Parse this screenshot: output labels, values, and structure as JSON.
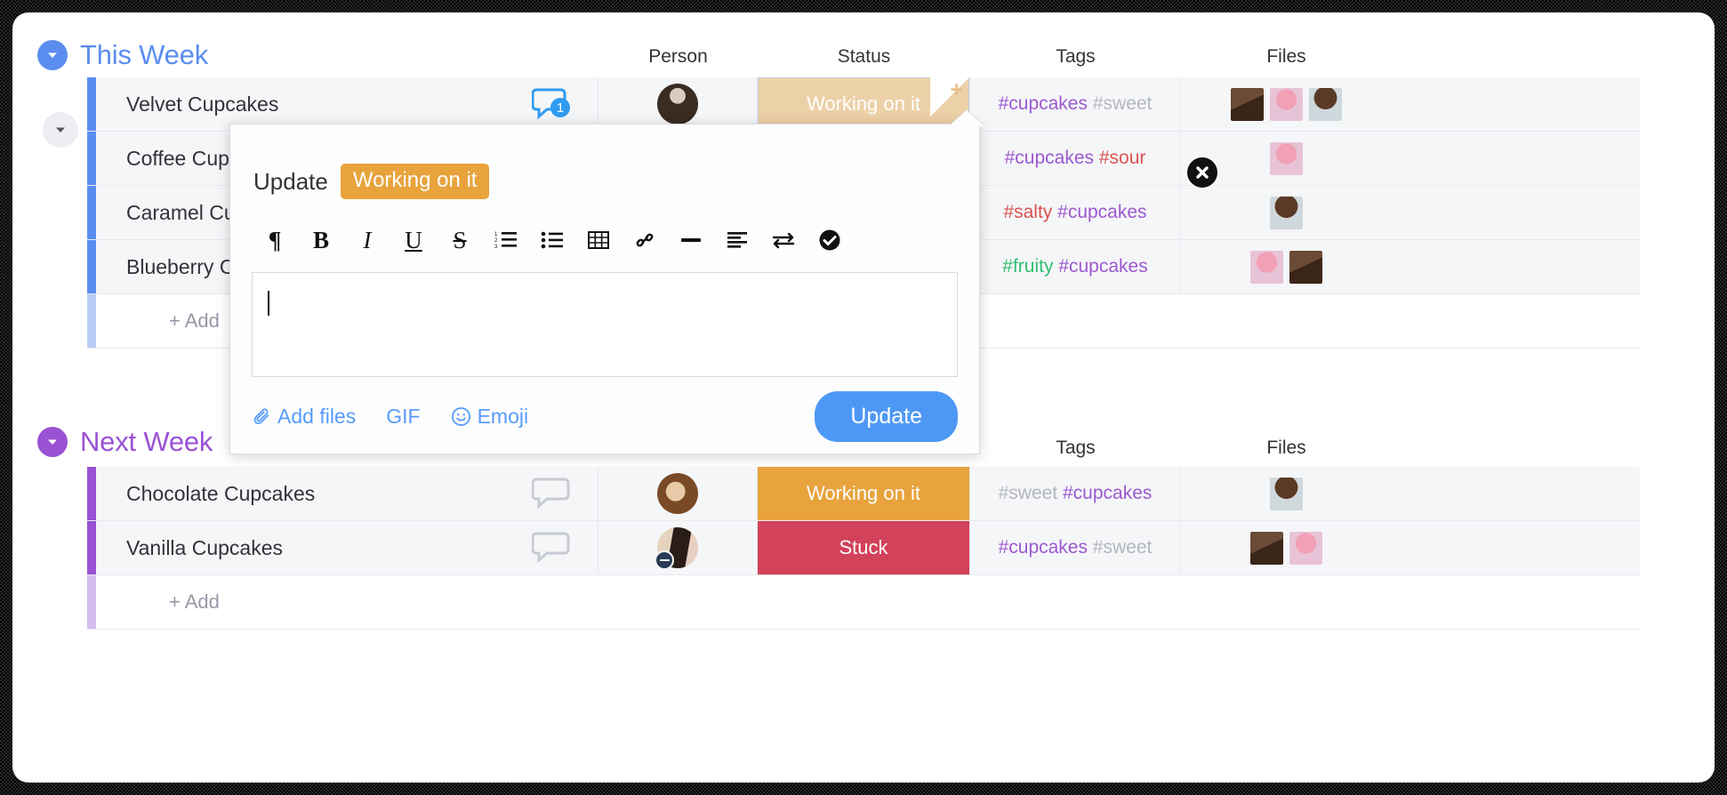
{
  "theme": {
    "this_week_accent": "#5b8def",
    "next_week_accent": "#9a52d4",
    "status_working": "#e8a33d",
    "status_working_selected": "#ecd0a7",
    "status_stuck": "#d2425a",
    "link_blue": "#579bfc",
    "button_blue": "#4e98f5",
    "tag_purple": "#9b59d0",
    "tag_grey": "#b3b6c0",
    "tag_red": "#d9534f",
    "tag_green": "#2fbf71"
  },
  "columns": {
    "person": "Person",
    "status": "Status",
    "tags": "Tags",
    "files": "Files"
  },
  "groups": [
    {
      "title": "This Week",
      "collapse_icon": "chevron-down-circle-icon",
      "add_label": "+ Add",
      "rows": [
        {
          "name": "Velvet Cupcakes",
          "comment_icon": "chat-bubble-icon",
          "comment_count": "1",
          "has_comments": true,
          "person_avatar": "avatar-woman-dark-hair",
          "person_badge": "",
          "status": "Working on it",
          "status_state": "selected",
          "fold_icon": "plus-icon",
          "tags": [
            {
              "text": "#cupcakes",
              "color": "#9b59d0"
            },
            {
              "text": "#sweet",
              "color": "#b3b6c0"
            }
          ],
          "files": [
            "chocolate-cupcake-thumb",
            "pink-cupcake-thumb",
            "choco-swirl-cupcake-thumb"
          ]
        },
        {
          "name": "Coffee Cupcakes",
          "comment_icon": "chat-bubble-icon",
          "comment_count": "",
          "has_comments": false,
          "person_avatar": "",
          "person_badge": "",
          "status": "",
          "status_state": "hidden",
          "tags": [
            {
              "text": "#cupcakes",
              "color": "#9b59d0"
            },
            {
              "text": "#sour",
              "color": "#d9534f"
            }
          ],
          "files": [
            "pink-cupcake-thumb"
          ]
        },
        {
          "name": "Caramel Cupcakes",
          "comment_icon": "chat-bubble-icon",
          "comment_count": "",
          "has_comments": false,
          "person_avatar": "",
          "person_badge": "",
          "status": "",
          "status_state": "hidden",
          "tags": [
            {
              "text": "#salty",
              "color": "#d9534f"
            },
            {
              "text": "#cupcakes",
              "color": "#9b59d0"
            }
          ],
          "files": [
            "choco-swirl-cupcake-thumb"
          ]
        },
        {
          "name": "Blueberry Cupcakes",
          "comment_icon": "chat-bubble-icon",
          "comment_count": "",
          "has_comments": false,
          "person_avatar": "",
          "person_badge": "",
          "status": "",
          "status_state": "hidden",
          "tags": [
            {
              "text": "#fruity",
              "color": "#2fbf71"
            },
            {
              "text": "#cupcakes",
              "color": "#9b59d0"
            }
          ],
          "files": [
            "pink-cupcake-thumb",
            "chocolate-cupcake-thumb"
          ]
        }
      ]
    },
    {
      "title": "Next Week",
      "collapse_icon": "chevron-down-circle-icon",
      "add_label": "+ Add",
      "rows": [
        {
          "name": "Chocolate Cupcakes",
          "comment_icon": "chat-bubble-icon",
          "comment_count": "",
          "has_comments": false,
          "person_avatar": "avatar-woman-curly-hair",
          "person_badge": "",
          "status": "Working on it",
          "status_state": "filled",
          "status_color": "#e8a33d",
          "tags": [
            {
              "text": "#sweet",
              "color": "#b3b6c0"
            },
            {
              "text": "#cupcakes",
              "color": "#9b59d0"
            }
          ],
          "files": [
            "choco-swirl-cupcake-thumb"
          ]
        },
        {
          "name": "Vanilla Cupcakes",
          "comment_icon": "chat-bubble-icon",
          "comment_count": "",
          "has_comments": false,
          "person_avatar": "avatar-woman-long-hair",
          "person_badge": "do-not-disturb-badge",
          "status": "Stuck",
          "status_state": "filled",
          "status_color": "#d2425a",
          "tags": [
            {
              "text": "#cupcakes",
              "color": "#9b59d0"
            },
            {
              "text": "#sweet",
              "color": "#b3b6c0"
            }
          ],
          "files": [
            "chocolate-cupcake-thumb",
            "pink-cupcake-thumb"
          ]
        }
      ]
    }
  ],
  "popup": {
    "label": "Update",
    "status_chip": "Working on it",
    "close_icon": "close-x-icon",
    "editor_value": "",
    "editor_placeholder": "",
    "toolbar": [
      {
        "name": "paragraph-icon",
        "glyph": "¶",
        "style": ""
      },
      {
        "name": "bold-icon",
        "glyph": "B",
        "style": "bold"
      },
      {
        "name": "italic-icon",
        "glyph": "I",
        "style": "ital"
      },
      {
        "name": "underline-icon",
        "glyph": "U",
        "style": "und"
      },
      {
        "name": "strikethrough-icon",
        "glyph": "S",
        "style": "strk"
      },
      {
        "name": "ordered-list-icon",
        "glyph": "",
        "style": "svg-ol"
      },
      {
        "name": "bullet-list-icon",
        "glyph": "",
        "style": "svg-ul"
      },
      {
        "name": "table-icon",
        "glyph": "",
        "style": "svg-table"
      },
      {
        "name": "link-icon",
        "glyph": "",
        "style": "svg-link"
      },
      {
        "name": "horizontal-rule-icon",
        "glyph": "",
        "style": "svg-hr"
      },
      {
        "name": "align-left-icon",
        "glyph": "",
        "style": "svg-align"
      },
      {
        "name": "exchange-arrows-icon",
        "glyph": "",
        "style": "svg-swap"
      },
      {
        "name": "check-circle-icon",
        "glyph": "",
        "style": "svg-check"
      }
    ],
    "add_files_label": "Add files",
    "add_files_icon": "paperclip-icon",
    "gif_label": "GIF",
    "emoji_label": "Emoji",
    "emoji_icon": "smiley-icon",
    "update_button": "Update"
  }
}
